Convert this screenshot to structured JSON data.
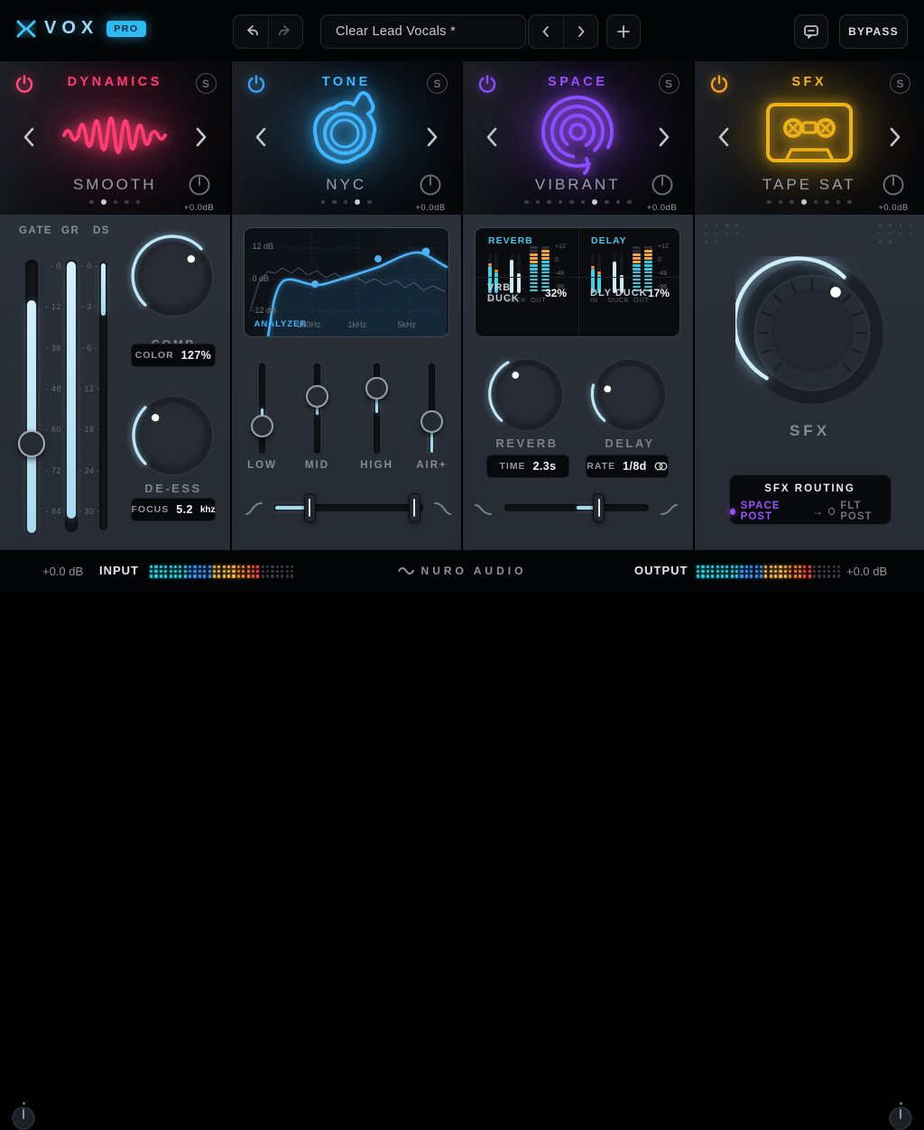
{
  "topbar": {
    "logo_text": "VOX",
    "logo_badge": "PRO",
    "preset_name": "Clear Lead Vocals *",
    "bypass_label": "BYPASS"
  },
  "modules": [
    {
      "title": "DYNAMICS",
      "preset": "SMOOTH",
      "gain": "+0.0dB",
      "color": "#ff3d73",
      "dots_total": 5,
      "dot_active": 1,
      "solo": "S"
    },
    {
      "title": "TONE",
      "preset": "NYC",
      "gain": "+0.0dB",
      "color": "#3fb6ff",
      "dots_total": 5,
      "dot_active": 3,
      "solo": "S"
    },
    {
      "title": "SPACE",
      "preset": "VIBRANT",
      "gain": "+0.0dB",
      "color": "#9b51ff",
      "dots_total": 10,
      "dot_active": 6,
      "solo": "S"
    },
    {
      "title": "SFX",
      "preset": "TAPE SAT",
      "gain": "+0.0dB",
      "color": "#f0b429",
      "dots_total": 8,
      "dot_active": 3,
      "solo": "S"
    }
  ],
  "dynamics": {
    "meter_labels": [
      "GATE",
      "GR",
      "DS"
    ],
    "scale_left": [
      "- 0",
      "- 12",
      "- 36",
      "- 48",
      "- 60",
      "- 72",
      "- 84"
    ],
    "scale_right": [
      "- 0 -",
      "- 3 -",
      "- 6 -",
      "- 12 -",
      "- 18 -",
      "- 24 -",
      "- 30 -"
    ],
    "comp": {
      "label": "COMP",
      "field_label": "COLOR",
      "field_value": "127%"
    },
    "deess": {
      "label": "DE-ESS",
      "field_label": "FOCUS",
      "field_value": "5.2",
      "field_unit": "khz"
    }
  },
  "tone": {
    "eq": {
      "analyzer_label": "ANALYZER",
      "db_labels": [
        "12 dB",
        "0 dB",
        "-12 dB"
      ],
      "freq_labels": [
        "180Hz",
        "1kHz",
        "5kHz"
      ]
    },
    "sliders": [
      {
        "label": "LOW"
      },
      {
        "label": "MID"
      },
      {
        "label": "HIGH"
      },
      {
        "label": "AIR+"
      }
    ]
  },
  "space": {
    "out_scale": [
      "+12",
      "0",
      "-48",
      "-96"
    ],
    "out_profiles": [
      [
        8,
        3,
        2
      ],
      [
        9,
        3,
        1
      ]
    ],
    "sections": [
      {
        "title": "REVERB",
        "meter_labels": [
          "IN",
          "DUCK",
          "OUT"
        ],
        "duck_label": "VRB DUCK",
        "duck_value": "32%",
        "knob_label": "REVERB",
        "field_label": "TIME",
        "field_value": "2.3s"
      },
      {
        "title": "DELAY",
        "meter_labels": [
          "IN",
          "DUCK",
          "OUT"
        ],
        "duck_label": "DLY DUCK",
        "duck_value": "17%",
        "knob_label": "DELAY",
        "field_label": "RATE",
        "field_value": "1/8d"
      }
    ]
  },
  "sfx": {
    "knob_label": "SFX",
    "routing": {
      "title": "SFX ROUTING",
      "from": "SPACE POST",
      "arrow": "→",
      "to": "FLT POST"
    }
  },
  "footer": {
    "input_gain": "+0.0 dB",
    "input_label": "INPUT",
    "output_label": "OUTPUT",
    "output_gain": "+0.0 dB",
    "brand": "NURO AUDIO",
    "meters": {
      "palette": [
        "#2ec9db",
        "#3f8de8",
        "#eeb34a",
        "#ef7f39",
        "#e84b42",
        "#383c45"
      ],
      "input": [
        8,
        5,
        5,
        3,
        2,
        7
      ],
      "output": [
        9,
        5,
        5,
        3,
        2,
        6
      ]
    }
  }
}
